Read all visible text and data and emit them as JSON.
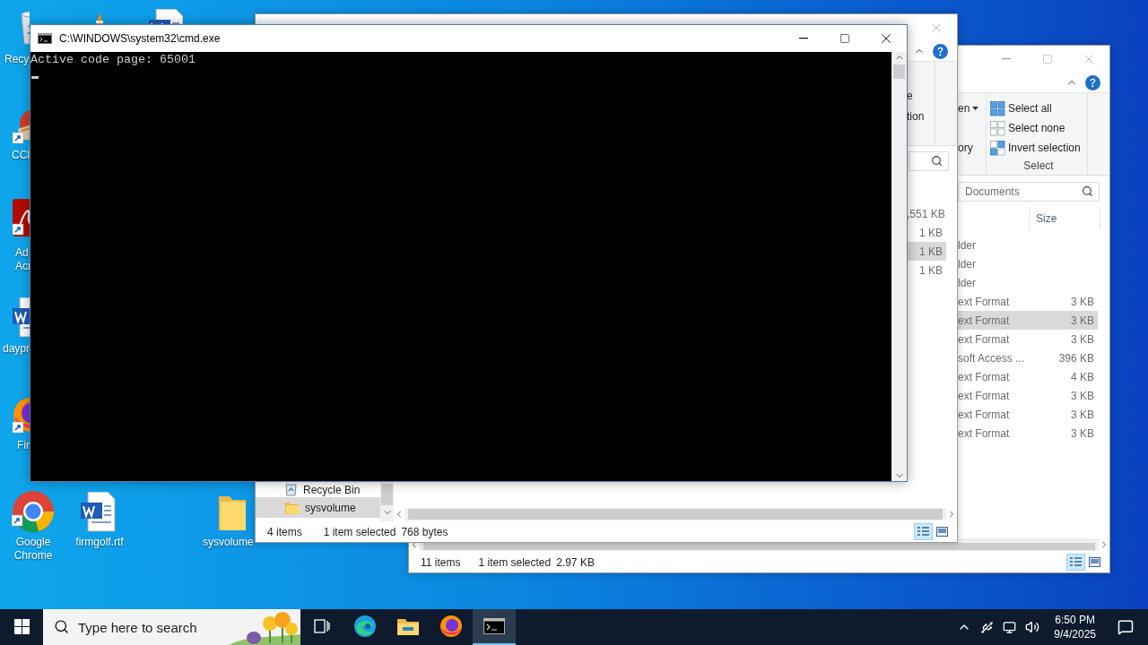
{
  "desktop": {
    "icons": [
      {
        "kind": "recycle-bin",
        "lines": [
          "Recy"
        ]
      },
      {
        "kind": "cone"
      },
      {
        "kind": "word-doc"
      },
      {
        "kind": "cleaner",
        "shortcut": true,
        "lines": [
          "CCl"
        ]
      },
      {
        "kind": "pdf",
        "shortcut": true,
        "lines": [
          "Ad",
          "Acr"
        ]
      },
      {
        "kind": "word-doc",
        "lines": [
          "daypr"
        ]
      },
      {
        "kind": "fox",
        "shortcut": true,
        "lines": [
          "Fir"
        ]
      },
      {
        "kind": "chrome",
        "shortcut": true,
        "lines": [
          "Google",
          "Chrome"
        ]
      },
      {
        "kind": "word-doc",
        "lines": [
          "firmgolf.rtf"
        ]
      },
      {
        "kind": "folder",
        "lines": [
          "sysvolume"
        ]
      }
    ]
  },
  "explorer_back": {
    "ribbon": {
      "cut_labels": [
        {
          "text": "en",
          "dropdown": true
        },
        {
          "text": "ory",
          "dropdown": false
        }
      ],
      "select_group": {
        "title": "Select",
        "items": [
          {
            "label": "Select all",
            "kind": "all"
          },
          {
            "label": "Select none",
            "kind": "none"
          },
          {
            "label": "Invert selection",
            "kind": "invert"
          }
        ]
      }
    },
    "search": {
      "placeholder": "Documents"
    },
    "columns": [
      "Size"
    ],
    "rows": [
      {
        "type": "lder",
        "selected": false
      },
      {
        "type": "lder",
        "selected": false
      },
      {
        "type": "lder",
        "selected": false
      },
      {
        "type": "ext Format",
        "size": "3 KB",
        "selected": false
      },
      {
        "type": "ext Format",
        "size": "3 KB",
        "selected": true
      },
      {
        "type": "ext Format",
        "size": "3 KB",
        "selected": false
      },
      {
        "type": "soft Access ...",
        "size": "396 KB",
        "selected": false
      },
      {
        "type": "ext Format",
        "size": "4 KB",
        "selected": false
      },
      {
        "type": "ext Format",
        "size": "3 KB",
        "selected": false
      },
      {
        "type": "ext Format",
        "size": "3 KB",
        "selected": false
      },
      {
        "type": "ext Format",
        "size": "3 KB",
        "selected": false
      }
    ],
    "status": {
      "count": "11 items",
      "selection": "1 item selected",
      "size": "2.97 KB"
    },
    "view_buttons": [
      {
        "kind": "details",
        "selected": true
      },
      {
        "kind": "large-icons",
        "selected": false
      }
    ]
  },
  "explorer_front": {
    "ribbon": {
      "cut_labels": [
        "e",
        "tion"
      ]
    },
    "rows": [
      {
        "size": ",551 KB",
        "selected": false
      },
      {
        "size": "1 KB",
        "selected": false
      },
      {
        "size": "1 KB",
        "selected": true
      },
      {
        "size": "1 KB",
        "selected": false
      }
    ],
    "nav": [
      {
        "label": "Recycle Bin",
        "kind": "recycle-bin",
        "selected": false
      },
      {
        "label": "sysvolume",
        "kind": "folder",
        "selected": true
      }
    ],
    "status": {
      "count": "4 items",
      "selection": "1 item selected",
      "size": "768 bytes"
    },
    "view_buttons": [
      {
        "kind": "details",
        "selected": true
      },
      {
        "kind": "large-icons",
        "selected": false
      }
    ]
  },
  "console": {
    "title": "C:\\WINDOWS\\system32\\cmd.exe",
    "lines": [
      "Active code page: 65001"
    ]
  },
  "taskbar": {
    "search": {
      "placeholder": "Type here to search"
    },
    "apps": [
      {
        "kind": "task-view",
        "active": false
      },
      {
        "kind": "edge",
        "active": false
      },
      {
        "kind": "explorer",
        "active": false
      },
      {
        "kind": "firefox",
        "active": false
      },
      {
        "kind": "console",
        "active": true
      }
    ],
    "clock": {
      "time": "6:50 PM",
      "date": "9/4/2025"
    }
  }
}
